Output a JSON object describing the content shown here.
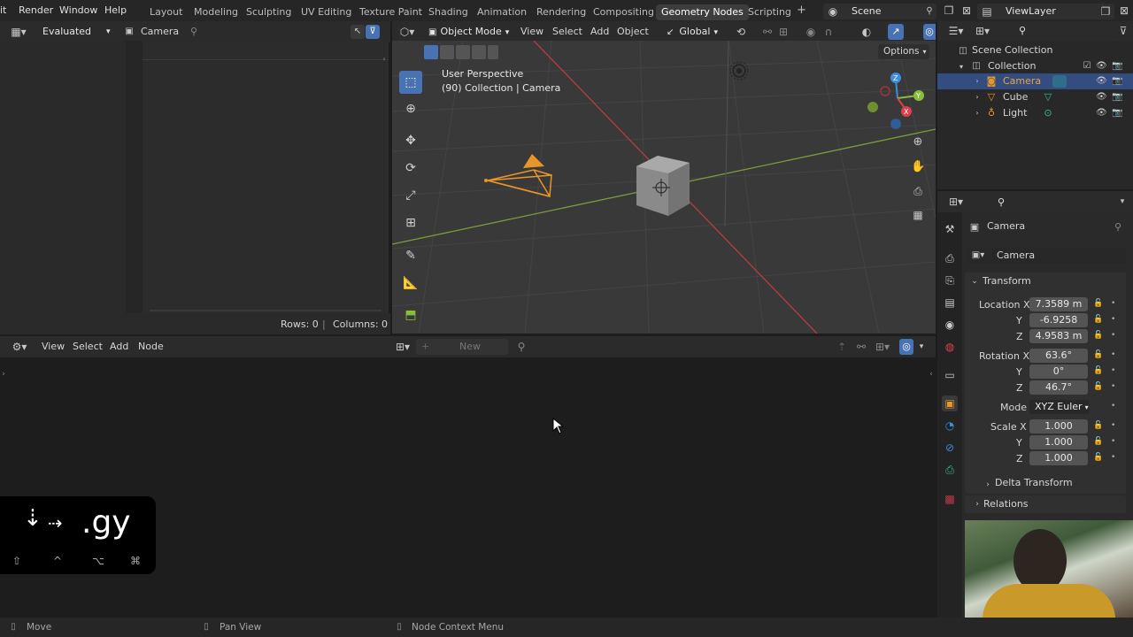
{
  "topbar": {
    "menus": [
      "it",
      "Render",
      "Window",
      "Help"
    ],
    "workspaces": [
      "Layout",
      "Modeling",
      "Sculpting",
      "UV Editing",
      "Texture Paint",
      "Shading",
      "Animation",
      "Rendering",
      "Compositing",
      "Geometry Nodes",
      "Scripting"
    ],
    "active_workspace": "Geometry Nodes",
    "add_tab": "+",
    "scene": "Scene",
    "view_layer": "ViewLayer"
  },
  "spreadsheet": {
    "mode": "Evaluated",
    "object": "Camera",
    "rows_label": "Rows: 0",
    "separator": "|",
    "columns_label": "Columns: 0"
  },
  "viewport": {
    "mode": "Object Mode",
    "menus": [
      "View",
      "Select",
      "Add",
      "Object"
    ],
    "orientation": "Global",
    "options": "Options",
    "perspective": "User Perspective",
    "collection_info": "(90) Collection | Camera",
    "gizmo": {
      "x": "X",
      "y": "Y",
      "z": "Z"
    }
  },
  "outliner": {
    "scene_collection": "Scene Collection",
    "collection": "Collection",
    "items": [
      "Camera",
      "Cube",
      "Light"
    ],
    "selected": "Camera"
  },
  "properties": {
    "object_name": "Camera",
    "datablock": "Camera",
    "transform_label": "Transform",
    "location": {
      "label": "Location X",
      "x": "7.3589 m",
      "y": "-6.9258",
      "z": "4.9583 m"
    },
    "rotation": {
      "label": "Rotation X",
      "x": "63.6°",
      "y": "0°",
      "z": "46.7°"
    },
    "mode_label": "Mode",
    "mode_value": "XYZ Euler",
    "scale": {
      "label": "Scale X",
      "x": "1.000",
      "y": "1.000",
      "z": "1.000"
    },
    "axis_y": "Y",
    "axis_z": "Z",
    "delta_transform": "Delta Transform",
    "relations": "Relations"
  },
  "node_editor": {
    "menus": [
      "View",
      "Select",
      "Add",
      "Node"
    ],
    "new_label": "New"
  },
  "key_overlay": {
    "text": ".gy",
    "modifiers": [
      "⇧",
      "^",
      "⌥",
      "⌘"
    ]
  },
  "statusbar": {
    "items": [
      "Move",
      "Pan View",
      "Node Context Menu"
    ]
  },
  "colors": {
    "accent_blue": "#4772b3",
    "selected_row": "#334d80",
    "camera_orange": "#e8962a",
    "axis_x": "#e0414c",
    "axis_y": "#8bbd3c",
    "axis_z": "#3d8ee0"
  }
}
